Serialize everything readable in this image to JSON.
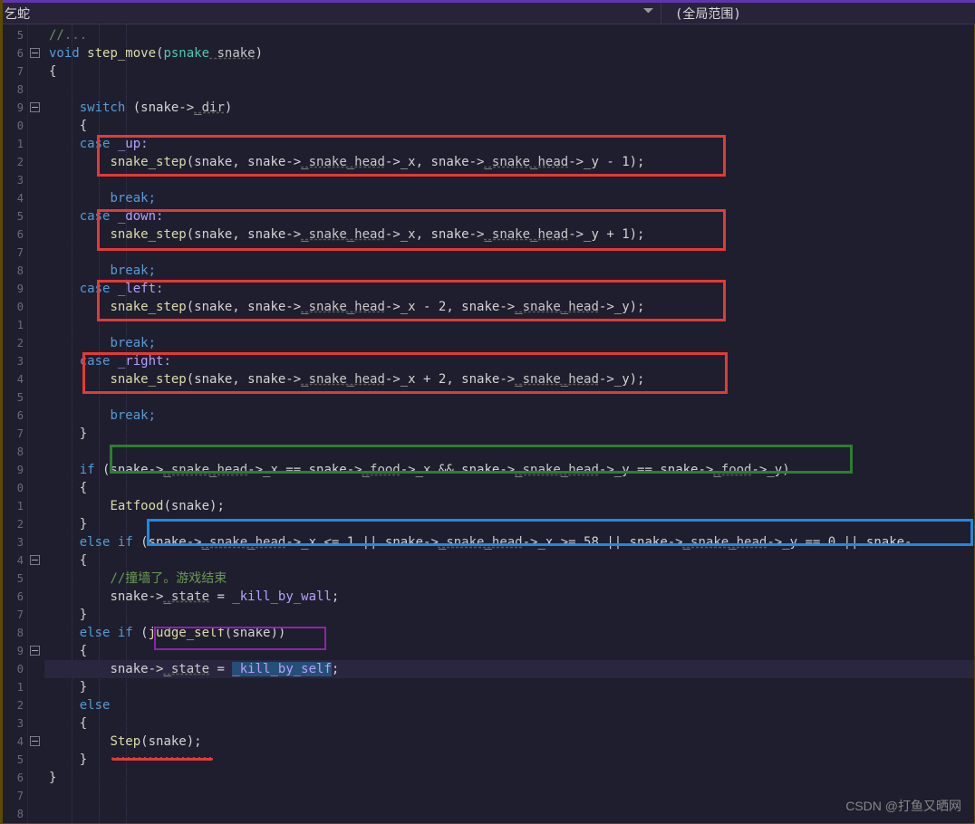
{
  "toolbar": {
    "left_label": "乞蛇",
    "right_label": "(全局范围)"
  },
  "line_numbers": [
    "5",
    "6",
    "7",
    "8",
    "9",
    "0",
    "1",
    "2",
    "3",
    "4",
    "5",
    "6",
    "7",
    "8",
    "9",
    "0",
    "1",
    "2",
    "3",
    "4",
    "5",
    "6",
    "7",
    "8",
    "9",
    "0",
    "1",
    "2",
    "3",
    "4",
    "5",
    "6",
    "7",
    "8",
    "9",
    "0",
    "1",
    "2",
    "3",
    "4",
    "5",
    "6",
    "7",
    "8"
  ],
  "code": {
    "l0": {
      "t": "void",
      "f": "step_move",
      "p": "(",
      "pt": "psnake",
      "v": " snake",
      ")": ")"
    },
    "l1": "{",
    "l2_switch": "switch",
    "l2_v": " (snake->",
    "l2_m": "_dir",
    "l2_end": ")",
    "l3": "{",
    "case_up": "case",
    "up": " _up:",
    "ss": "snake_step",
    "ss_args1": "(snake, snake->",
    "sh": "_snake_head",
    "x": "->_x",
    "y": "->_y",
    "ym": " - 1",
    ")": ");",
    "yp": " + 1",
    "xm": " - 2",
    "xp": " + 2",
    "break": "break;",
    "case_down": "case",
    "down": " _down:",
    "case_left": "case",
    "left": " _left:",
    "case_right": "case",
    "right": " _right:",
    "rb": "}",
    "if": "if",
    "elseif": "else if",
    "else": "else",
    "cond_food_a": " (snake->",
    "cond_food_b": "->_x == snake->",
    "food": "_food",
    "cond_food_c": "->_x && snake->",
    "cond_food_d": "->_y == snake->",
    "cond_food_e": "->_y)",
    "eatfood": "Eatfood",
    "eat_args": "(snake);",
    "cond_wall_a": " (snake->",
    "cond_wall_b": "->_x <= 1 || snake->",
    "cond_wall_c": "->_x >= 58 || snake->",
    "cond_wall_d": "->_y == 0 || snake-",
    "comment_wall": "//撞墙了。游戏结束",
    "state": "snake->",
    "state_m": "_state",
    "eq": " = ",
    "kbw": "_kill_by_wall",
    ";": ";",
    "judge": "judge_self",
    "judge_args": "(snake))",
    "pre": " (",
    "kbs": "_kill_by_self",
    "step": "Step",
    "step_args": "(snake);"
  },
  "fold_rows": [
    1,
    4,
    29,
    34,
    39
  ],
  "watermark": "CSDN @打鱼又晒网",
  "chart_data": null
}
